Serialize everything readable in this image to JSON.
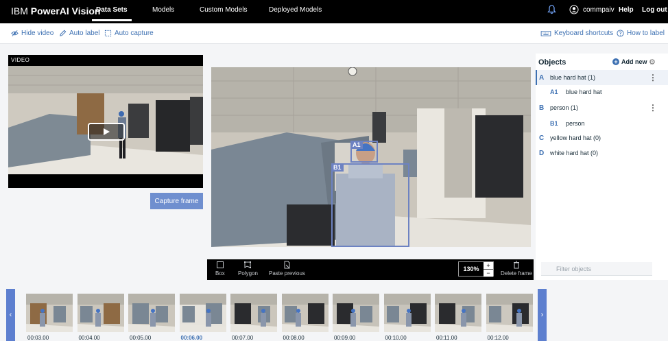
{
  "app": {
    "brand_prefix": "IBM",
    "brand_name": "PowerAI Vision"
  },
  "nav": {
    "tabs": [
      {
        "label": "Data Sets",
        "active": true
      },
      {
        "label": "Models",
        "active": false
      },
      {
        "label": "Custom Models",
        "active": false
      },
      {
        "label": "Deployed Models",
        "active": false
      }
    ],
    "username": "commpaiv",
    "help": "Help",
    "logout": "Log out"
  },
  "toolbar": {
    "hide_video": "Hide video",
    "auto_label": "Auto label",
    "auto_capture": "Auto capture",
    "keyboard_shortcuts": "Keyboard shortcuts",
    "how_to_label": "How to label"
  },
  "video": {
    "label": "VIDEO",
    "capture_button": "Capture frame"
  },
  "canvas": {
    "boxes": [
      {
        "tag": "A1"
      },
      {
        "tag": "B1"
      }
    ],
    "tools": {
      "box": "Box",
      "polygon": "Polygon",
      "paste_previous": "Paste previous",
      "delete_frame": "Delete frame"
    },
    "zoom": "130%",
    "zoom_in": "+",
    "zoom_out": "−"
  },
  "objects": {
    "title": "Objects",
    "add_new": "Add new",
    "items": [
      {
        "letter": "A",
        "name": "blue hard hat (1)",
        "selected": true,
        "instances": [
          {
            "id": "A1",
            "name": "blue hard hat"
          }
        ]
      },
      {
        "letter": "B",
        "name": "person (1)",
        "selected": false,
        "instances": [
          {
            "id": "B1",
            "name": "person"
          }
        ]
      },
      {
        "letter": "C",
        "name": "yellow hard hat (0)",
        "selected": false,
        "instances": []
      },
      {
        "letter": "D",
        "name": "white hard hat (0)",
        "selected": false,
        "instances": []
      }
    ],
    "filter_placeholder": "Filter objects"
  },
  "filmstrip": {
    "frames": [
      {
        "time": "00:03.00",
        "active": false
      },
      {
        "time": "00:04.00",
        "active": false
      },
      {
        "time": "00:05.00",
        "active": false
      },
      {
        "time": "00:06.00",
        "active": true
      },
      {
        "time": "00:07.00",
        "active": false
      },
      {
        "time": "00:08.00",
        "active": false
      },
      {
        "time": "00:09.00",
        "active": false
      },
      {
        "time": "00:10.00",
        "active": false
      },
      {
        "time": "00:11.00",
        "active": false
      },
      {
        "time": "00:12.00",
        "active": false
      }
    ],
    "prev_arrow": "‹",
    "next_arrow": "›"
  },
  "colors": {
    "accent": "#3d70b2",
    "bbox": "#6d82c2",
    "nav_bg": "#000000",
    "capture_button": "#6f8fcf"
  }
}
